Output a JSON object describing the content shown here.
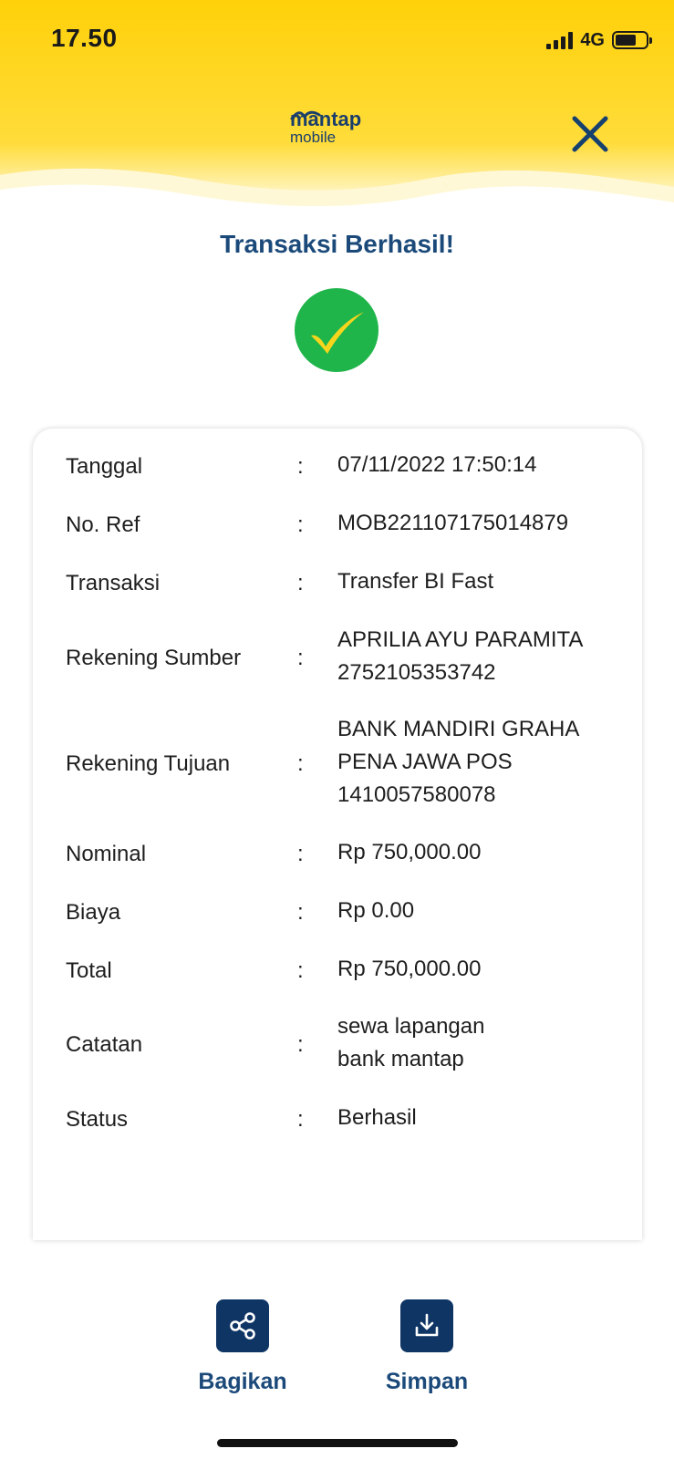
{
  "status_bar": {
    "time": "17.50",
    "network": "4G"
  },
  "header": {
    "logo_top": "mantap",
    "logo_bottom": "mobile",
    "brand_color": "#FFD10A",
    "close_icon": "close-icon"
  },
  "result": {
    "title": "Transaksi Berhasil!",
    "icon": "success-check-icon",
    "success_color": "#1FB54A"
  },
  "details": [
    {
      "label": "Tanggal",
      "value": "07/11/2022 17:50:14"
    },
    {
      "label": "No. Ref",
      "value": "MOB221107175014879"
    },
    {
      "label": "Transaksi",
      "value": "Transfer BI Fast"
    },
    {
      "label": "Rekening Sumber",
      "value": "APRILIA AYU PARAMITA\n2752105353742"
    },
    {
      "label": "Rekening Tujuan",
      "value": "BANK MANDIRI GRAHA\nPENA JAWA POS\n1410057580078"
    },
    {
      "label": "Nominal",
      "value": "Rp 750,000.00"
    },
    {
      "label": "Biaya",
      "value": "Rp 0.00"
    },
    {
      "label": "Total",
      "value": "Rp 750,000.00"
    },
    {
      "label": "Catatan",
      "value": "sewa lapangan\nbank mantap"
    },
    {
      "label": "Status",
      "value": "Berhasil"
    }
  ],
  "separator": ":",
  "actions": {
    "share_label": "Bagikan",
    "share_icon": "share-icon",
    "save_label": "Simpan",
    "save_icon": "download-icon"
  }
}
